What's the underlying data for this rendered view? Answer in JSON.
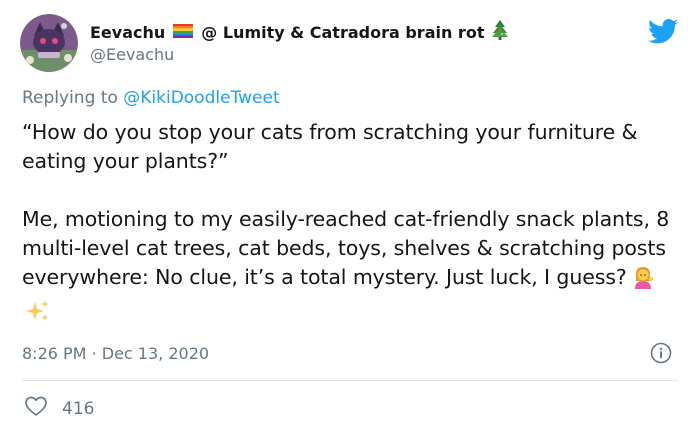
{
  "author": {
    "display_name": "Eevachu",
    "display_name_suffix": "@ Lumity & Catradora brain rot",
    "handle": "@Eevachu",
    "avatar_icon": "purple-cat-avatar-icon",
    "flag_icon": "rainbow-flag-icon",
    "suffix_icon": "christmas-tree-icon"
  },
  "brand_icon": "twitter-bird-icon",
  "reply": {
    "prefix": "Replying to",
    "mention": "@KikiDoodleTweet"
  },
  "tweet": {
    "paragraph_1": "“How do you stop your cats from scratching your furniture & eating your plants?”",
    "paragraph_2": "Me, motioning to my easily-reached cat-friendly snack plants, 8 multi-level cat trees, cat beds, toys, shelves & scratching posts everywhere: No clue, it’s a total mystery. Just luck, I guess?",
    "emojis": [
      "person-tipping-hand-icon",
      "sparkles-icon"
    ]
  },
  "meta": {
    "time": "8:26 PM",
    "separator": "·",
    "date": "Dec 13, 2020"
  },
  "likes": {
    "count": "416",
    "icon": "heart-icon"
  },
  "colors": {
    "text": "#14171a",
    "secondary": "#657786",
    "accent": "#1da1f2",
    "divider": "#e1e8ed"
  }
}
